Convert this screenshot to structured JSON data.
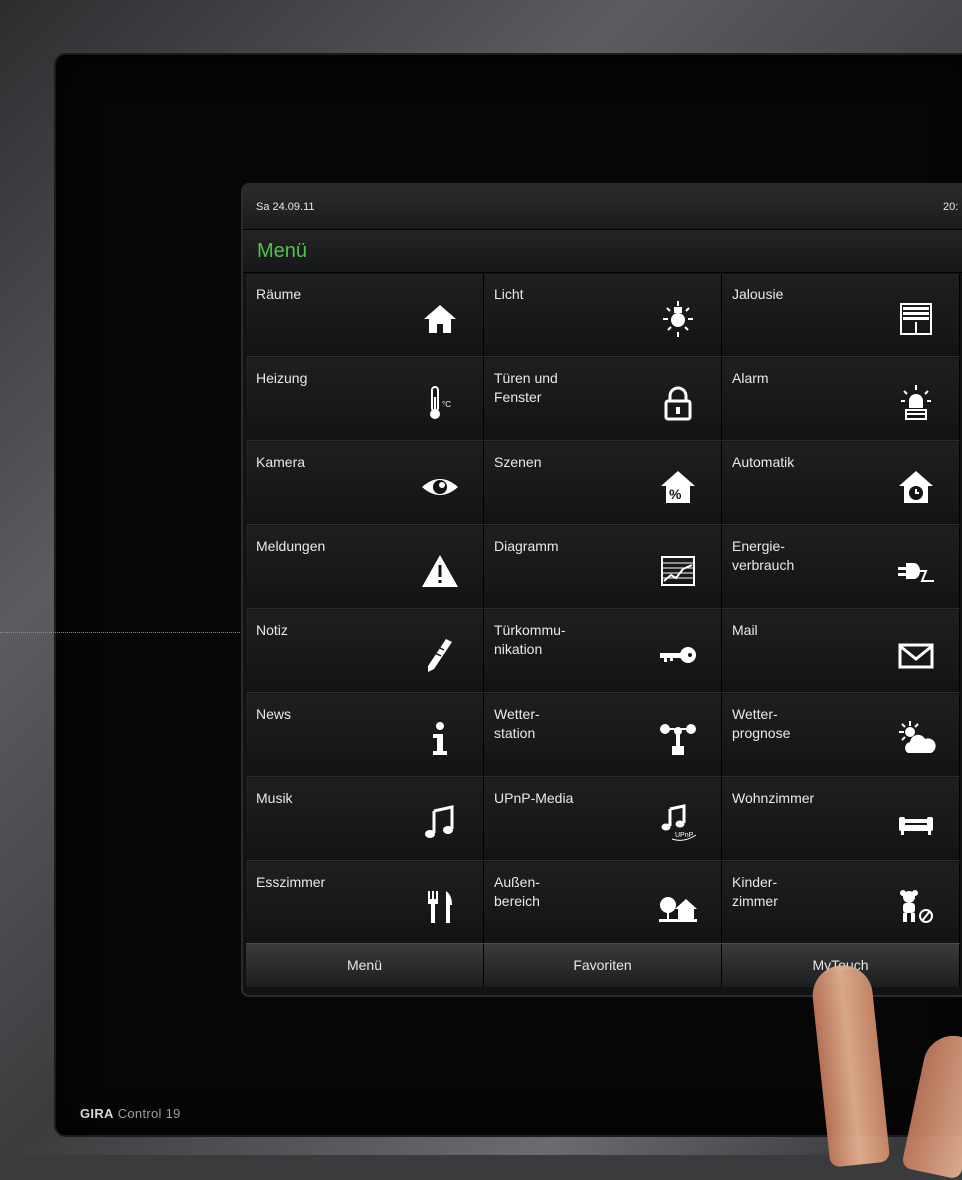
{
  "device": {
    "brand": "GIRA",
    "model": "Control 19"
  },
  "status": {
    "date": "Sa 24.09.11",
    "time": "20:"
  },
  "header": {
    "title": "Menü"
  },
  "colors": {
    "accent": "#4fc24a",
    "tile_bg": "#1b1c1d",
    "text": "#e9e9e9"
  },
  "tiles": [
    {
      "label": "Räume",
      "icon": "house-icon"
    },
    {
      "label": "Licht",
      "icon": "lightbulb-icon"
    },
    {
      "label": "Jalousie",
      "icon": "blinds-icon"
    },
    {
      "label": "Heizung",
      "icon": "thermometer-icon"
    },
    {
      "label": "Türen und\nFenster",
      "icon": "lock-icon"
    },
    {
      "label": "Alarm",
      "icon": "siren-icon"
    },
    {
      "label": "Kamera",
      "icon": "eye-icon"
    },
    {
      "label": "Szenen",
      "icon": "house-percent-icon"
    },
    {
      "label": "Automatik",
      "icon": "house-clock-icon"
    },
    {
      "label": "Meldungen",
      "icon": "warning-icon"
    },
    {
      "label": "Diagramm",
      "icon": "chart-icon"
    },
    {
      "label": "Energie-\nverbrauch",
      "icon": "plug-icon"
    },
    {
      "label": "Notiz",
      "icon": "pencil-icon"
    },
    {
      "label": "Türkommu-\nnikation",
      "icon": "key-icon"
    },
    {
      "label": "Mail",
      "icon": "envelope-icon"
    },
    {
      "label": "News",
      "icon": "info-icon"
    },
    {
      "label": "Wetter-\nstation",
      "icon": "anemometer-icon"
    },
    {
      "label": "Wetter-\nprognose",
      "icon": "sun-cloud-icon"
    },
    {
      "label": "Musik",
      "icon": "music-note-icon"
    },
    {
      "label": "UPnP-Media",
      "icon": "upnp-music-icon",
      "icon_text": "UPnP"
    },
    {
      "label": "Wohnzimmer",
      "icon": "sofa-icon"
    },
    {
      "label": "Esszimmer",
      "icon": "cutlery-icon"
    },
    {
      "label": "Außen-\nbereich",
      "icon": "tree-house-icon"
    },
    {
      "label": "Kinder-\nzimmer",
      "icon": "teddy-ball-icon"
    }
  ],
  "nav": [
    {
      "label": "Menü"
    },
    {
      "label": "Favoriten"
    },
    {
      "label": "MyTouch"
    }
  ]
}
